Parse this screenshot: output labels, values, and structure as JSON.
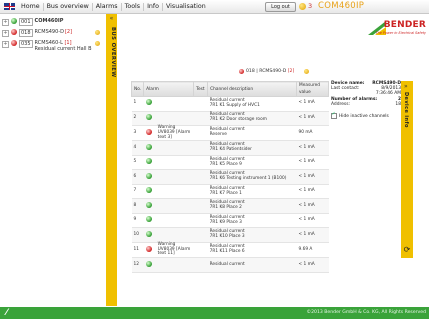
{
  "topbar": {
    "home_label": "Home",
    "bus_overview_label": "Bus overview",
    "alarms_label": "Alarms",
    "tools_label": "Tools",
    "info_label": "Info",
    "visualisation_label": "Visualisation",
    "logout_label": "Log out",
    "alarm_count": "3",
    "device_name": "COM460IP"
  },
  "tree": {
    "items": [
      {
        "expander": "+",
        "address": "001",
        "name": "COM460IP",
        "status": "green"
      },
      {
        "expander": "+",
        "address": "018",
        "name": "RCMS490-D",
        "suffix": "[2]",
        "status": "red",
        "warning": true
      },
      {
        "expander": "+",
        "address": "035",
        "name": "RCMS460-L",
        "suffix": "[1]",
        "sub": "Residual current Hall B",
        "status": "red",
        "warning": true
      }
    ]
  },
  "left_sidebar": {
    "label": "BUS OVERVIEW",
    "arrow": "«"
  },
  "logo": {
    "brand": "BENDER",
    "tagline": "The Power in Electrical Safety"
  },
  "panel": {
    "status_address": "018",
    "status_name": "RCMS490-D",
    "status_suffix": "[2]"
  },
  "table": {
    "headers": [
      "No.",
      "Alarm",
      "Test",
      "Channel description",
      "Measured value"
    ],
    "rows": [
      {
        "no": "1",
        "status": "green",
        "alarm": "",
        "test": "",
        "desc1": "Residual current",
        "desc2": "7R1 K1 Supply of HVC1",
        "value": "< 1 mA"
      },
      {
        "no": "2",
        "status": "green",
        "alarm": "",
        "test": "",
        "desc1": "Residual current",
        "desc2": "7R1 K2 Door storage room",
        "value": "< 1 mA"
      },
      {
        "no": "3",
        "status": "red",
        "alarm": "Warning UV8039 [Alarm text 3]",
        "test": "",
        "desc1": "Residual current",
        "desc2": "Reserve",
        "value": "90 mA"
      },
      {
        "no": "4",
        "status": "green",
        "alarm": "",
        "test": "",
        "desc1": "Residual current",
        "desc2": "7R1 K4 Patientsider",
        "value": "< 1 mA"
      },
      {
        "no": "5",
        "status": "green",
        "alarm": "",
        "test": "",
        "desc1": "Residual current",
        "desc2": "7R1 K5 Place 9",
        "value": "< 1 mA"
      },
      {
        "no": "6",
        "status": "green",
        "alarm": "",
        "test": "",
        "desc1": "Residual current",
        "desc2": "7R1 K6 Testing instrument 1 (B100)",
        "value": "< 1 mA"
      },
      {
        "no": "7",
        "status": "green",
        "alarm": "",
        "test": "",
        "desc1": "Residual current",
        "desc2": "7R1 K7 Place 1",
        "value": "< 1 mA"
      },
      {
        "no": "8",
        "status": "green",
        "alarm": "",
        "test": "",
        "desc1": "Residual current",
        "desc2": "7R1 K8 Place 2",
        "value": "< 1 mA"
      },
      {
        "no": "9",
        "status": "green",
        "alarm": "",
        "test": "",
        "desc1": "Residual current",
        "desc2": "7R1 K9 Place 3",
        "value": "< 1 mA"
      },
      {
        "no": "10",
        "status": "green",
        "alarm": "",
        "test": "",
        "desc1": "Residual current",
        "desc2": "7R1 K10 Place 3",
        "value": "< 1 mA"
      },
      {
        "no": "11",
        "status": "red",
        "alarm": "Warning UV8039 [Alarm text 11]",
        "test": "",
        "desc1": "Residual current",
        "desc2": "7R1 K11 Place 6",
        "value": "9.69 A"
      },
      {
        "no": "12",
        "status": "green",
        "alarm": "",
        "test": "",
        "desc1": "Residual current",
        "desc2": "",
        "value": "< 1 mA"
      }
    ]
  },
  "device_info": {
    "device_name_label": "Device name:",
    "device_name": "RCMS490-D",
    "last_contact_label": "Last contact:",
    "last_contact_date": "8/9/2013",
    "last_contact_time": "7:36:46 AM",
    "num_alarms_label": "Number of alarms:",
    "num_alarms": "2",
    "address_label": "Address:",
    "address": "18",
    "hide_inactive_label": "Hide inactive channels"
  },
  "right_sidebar": {
    "label": "Device info",
    "arrow": "»"
  },
  "footer": {
    "copyright": "©2013 Bender GmbH & Co. KG, All Rights Reserved"
  },
  "colors": {
    "accent": "#f0c000",
    "footer": "#3aa33a",
    "brand_red": "#cc2222",
    "alarm_red": "#d02020",
    "ok_green": "#2f9b2f"
  }
}
